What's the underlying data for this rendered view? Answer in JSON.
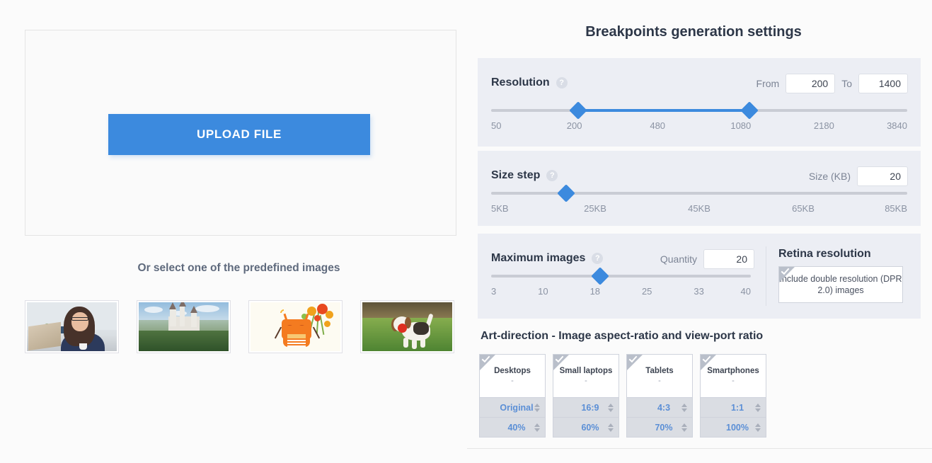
{
  "upload": {
    "button_label": "UPLOAD FILE",
    "predefined_heading": "Or select one of the predefined images",
    "thumbnails": [
      {
        "name": "woman-at-laptop"
      },
      {
        "name": "castle-on-hill"
      },
      {
        "name": "robot-with-flowers"
      },
      {
        "name": "beagle-puppy"
      }
    ]
  },
  "settings": {
    "title": "Breakpoints generation settings",
    "resolution": {
      "label": "Resolution",
      "help": "?",
      "from_label": "From",
      "from_value": "200",
      "to_label": "To",
      "to_value": "1400",
      "ticks": [
        "50",
        "200",
        "480",
        "1080",
        "2180",
        "3840"
      ],
      "handle_low_pct": 21,
      "handle_high_pct": 62
    },
    "size_step": {
      "label": "Size step",
      "help": "?",
      "field_label": "Size (KB)",
      "value": "20",
      "ticks": [
        "5KB",
        "25KB",
        "45KB",
        "65KB",
        "85KB"
      ],
      "handle_pct": 18
    },
    "maximum_images": {
      "label": "Maximum images",
      "help": "?",
      "field_label": "Quantity",
      "value": "20",
      "ticks": [
        "3",
        "10",
        "18",
        "25",
        "33",
        "40"
      ],
      "handle_pct": 42
    },
    "retina": {
      "title": "Retina resolution",
      "checkbox_label": "Include double resolution (DPR 2.0) images",
      "checked": false
    },
    "art_direction": {
      "title": "Art-direction - Image aspect-ratio and view-port ratio",
      "cards": [
        {
          "name": "Desktops",
          "sub": "-",
          "ratio": "Original",
          "percent": "40%",
          "checked": true
        },
        {
          "name": "Small laptops",
          "sub": "-",
          "ratio": "16:9",
          "percent": "60%",
          "checked": true
        },
        {
          "name": "Tablets",
          "sub": "-",
          "ratio": "4:3",
          "percent": "70%",
          "checked": true
        },
        {
          "name": "Smartphones",
          "sub": "-",
          "ratio": "1:1",
          "percent": "100%",
          "checked": true
        }
      ]
    }
  },
  "colors": {
    "accent": "#3c8ade",
    "panel": "#eceef4",
    "page": "#fbfbfb",
    "value_blue": "#5b8fd6"
  }
}
